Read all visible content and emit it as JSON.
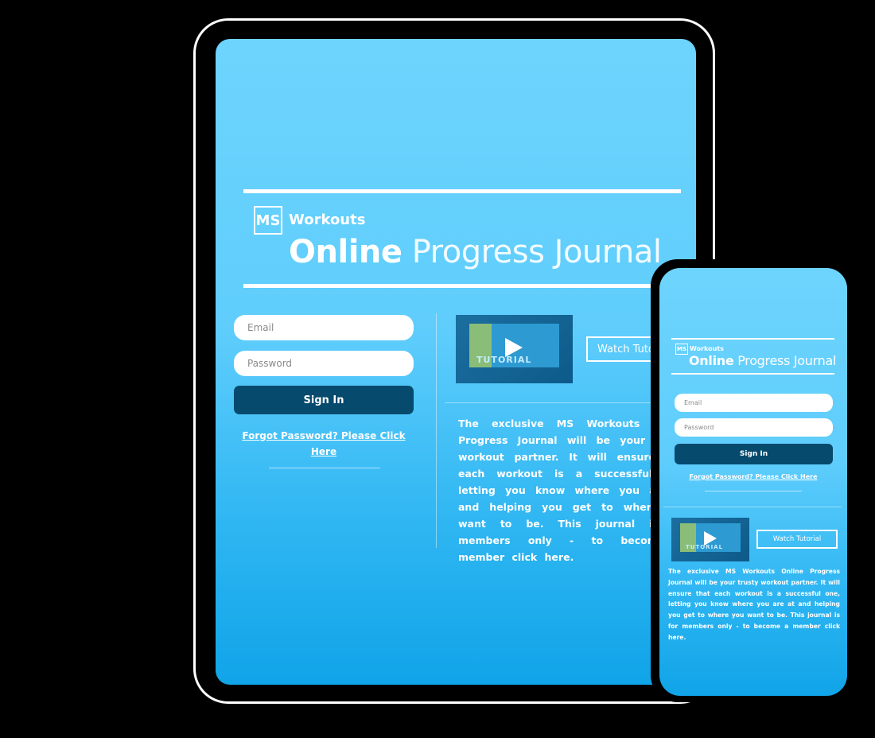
{
  "brand": {
    "logo_initials": "MS",
    "logo_word": "Workouts",
    "heading_bold": "Online",
    "heading_light": "Progress Journal"
  },
  "login": {
    "email_placeholder": "Email",
    "password_placeholder": "Password",
    "signin_label": "Sign In",
    "forgot_label": "Forgot Password? Please Click Here"
  },
  "tutorial": {
    "thumbnail_tag": "TUTORIAL",
    "watch_label": "Watch Tutorial"
  },
  "description": {
    "text": "The exclusive MS Workouts Online Progress Journal will be your trusty workout partner. It will ensure that each workout is a successful one, letting you know where you are at and helping you get to where you want to be. This journal is for members only - to become a member ",
    "link": "click here",
    "end": "."
  },
  "colors": {
    "screen_top": "#6dd4fd",
    "screen_bottom": "#10a4e8",
    "signin_bg": "#064a6d",
    "frame": "#000000"
  }
}
